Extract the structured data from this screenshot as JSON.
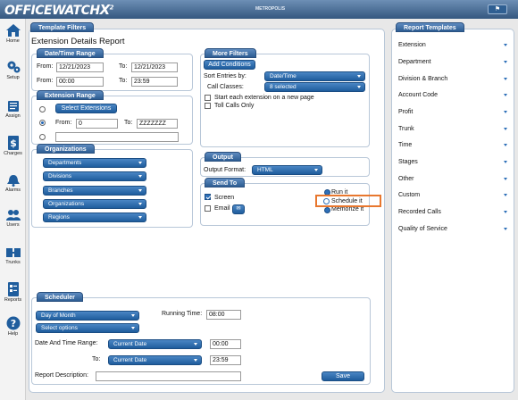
{
  "app": {
    "logo_main": "OFFICEWATCH",
    "logo_x": "X",
    "logo_sup": "2",
    "top_center": "METROPOLIS",
    "top_button": "⚑"
  },
  "sidebar": {
    "items": [
      {
        "label": "Home",
        "icon": "home-icon"
      },
      {
        "label": "Setup",
        "icon": "gears-icon"
      },
      {
        "label": "Assign",
        "icon": "assign-icon"
      },
      {
        "label": "Charges",
        "icon": "dollar-icon"
      },
      {
        "label": "Alarms",
        "icon": "alarm-icon"
      },
      {
        "label": "Users",
        "icon": "users-icon"
      },
      {
        "label": "Trunks",
        "icon": "trunks-icon"
      },
      {
        "label": "Reports",
        "icon": "reports-icon"
      },
      {
        "label": "Help",
        "icon": "help-icon"
      }
    ]
  },
  "template_filters": {
    "tab": "Template Filters",
    "report_title": "Extension Details Report",
    "datetime": {
      "title": "Date/Time Range",
      "from_label": "From:",
      "from_date": "12/21/2023",
      "from_time": "00:00",
      "to_label": "To:",
      "to_date": "12/21/2023",
      "to_time": "23:59"
    },
    "extension": {
      "title": "Extension Range",
      "select_button": "Select Extensions",
      "from_label": "From:",
      "from_value": "0",
      "to_label": "To:",
      "to_value": "ZZZZZZZ",
      "custom_value": ""
    },
    "organizations": {
      "title": "Organizations",
      "items": [
        "Departments",
        "Divisions",
        "Branches",
        "Organizations",
        "Regions"
      ]
    }
  },
  "more_filters": {
    "title": "More Filters",
    "add_button": "Add Conditions",
    "sort_label": "Sort Entries by:",
    "sort_value": "Date/Time",
    "call_classes_label": "Call Classes:",
    "call_classes_value": "8 selected",
    "check_new_page": "Start each extension on a new page",
    "check_toll": "Toll Calls Only"
  },
  "output": {
    "title": "Output",
    "format_label": "Output Format:",
    "format_value": "HTML"
  },
  "send_to": {
    "title": "Send To",
    "screen": "Screen",
    "email": "Email",
    "email_icon": "✉",
    "run_it": "Run it",
    "schedule_it": "Schedule it",
    "memorize_it": "Memorize it"
  },
  "scheduler": {
    "title": "Scheduler",
    "frequency": "Day of Month",
    "options": "Select options",
    "running_time_label": "Running Time:",
    "running_time": "08:00",
    "dtr_label": "Date And Time Range:",
    "dtr_start": "Current Date",
    "dtr_start_time": "00:00",
    "to_label": "To:",
    "dtr_end": "Current Date",
    "dtr_end_time": "23:59",
    "desc_label": "Report Description:",
    "desc_value": "",
    "save_button": "Save"
  },
  "report_templates": {
    "title": "Report Templates",
    "items": [
      "Extension",
      "Department",
      "Division & Branch",
      "Account Code",
      "Profit",
      "Trunk",
      "Time",
      "Stages",
      "Other",
      "Custom",
      "Recorded Calls",
      "Quality of Service"
    ]
  },
  "colors": {
    "accent": "#2d6fb8",
    "highlight": "#e8772e",
    "header": "#34577f"
  }
}
